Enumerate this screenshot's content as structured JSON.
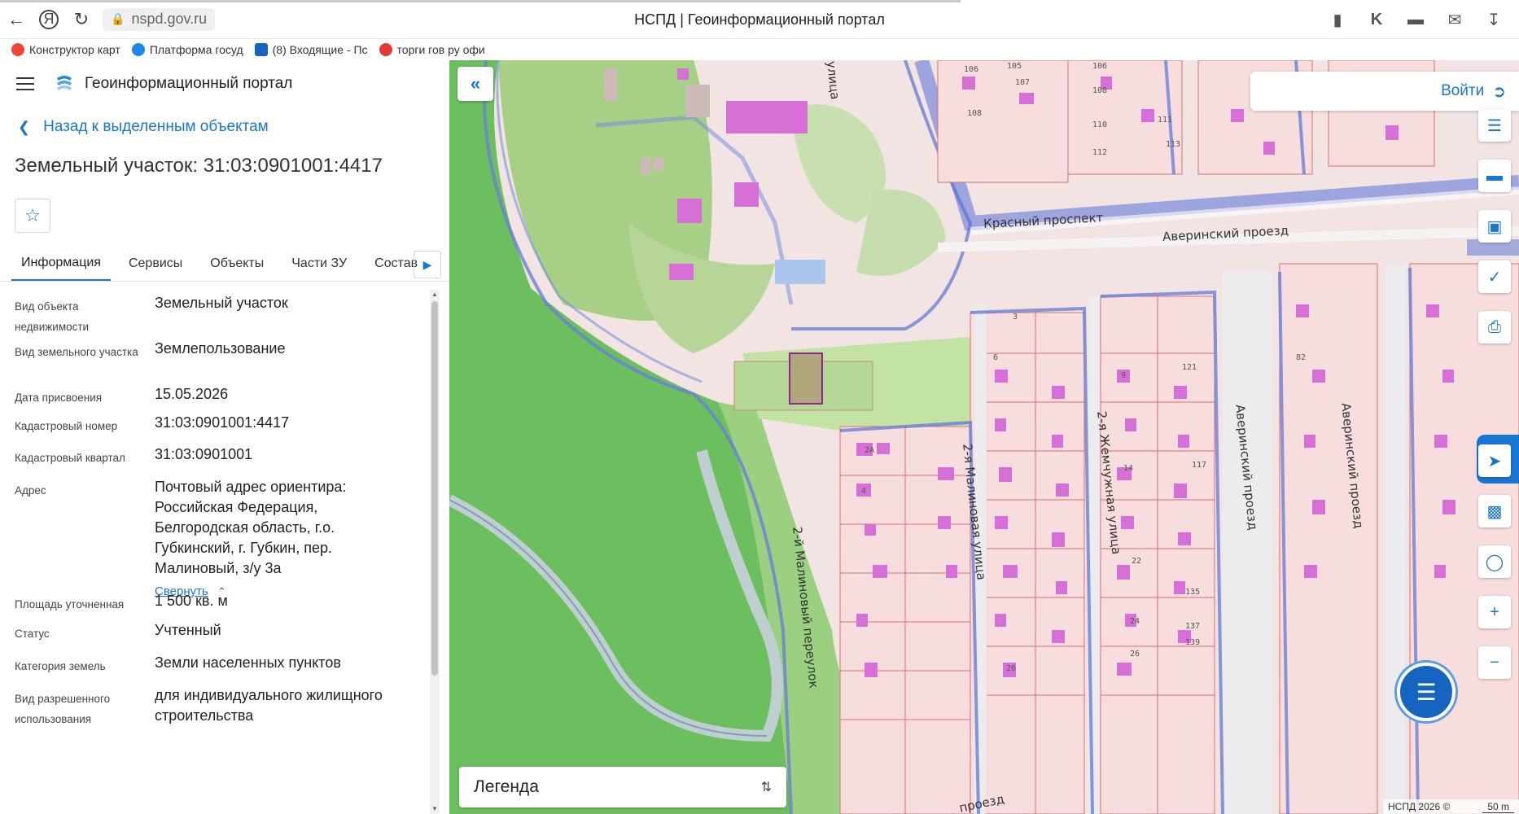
{
  "browser": {
    "url": "nspd.gov.ru",
    "page_title": "НСПД | Геоинформационный портал",
    "bookmarks": [
      {
        "label": "Конструктор карт",
        "color": "#f44336"
      },
      {
        "label": "Платформа госуд",
        "color": "#1e88e5"
      },
      {
        "label": "(8) Входящие - Пс",
        "color": "#1565c0"
      },
      {
        "label": "торги гов ру офи",
        "color": "#e53935"
      }
    ]
  },
  "app": {
    "title": "Геоинформационный портал",
    "back_label": "Назад к выделенным объектам",
    "object_title": "Земельный участок: 31:03:0901001:4417",
    "tabs": [
      {
        "label": "Информация",
        "active": true
      },
      {
        "label": "Сервисы"
      },
      {
        "label": "Объекты"
      },
      {
        "label": "Части ЗУ"
      },
      {
        "label": "Состав"
      }
    ],
    "fields": [
      {
        "label": "Вид объекта недвижимости",
        "value": "Земельный участок"
      },
      {
        "label": "Вид земельного участка",
        "value": "Землепользование"
      },
      {
        "label": "Дата присвоения",
        "value": "15.05.2026"
      },
      {
        "label": "Кадастровый номер",
        "value": "31:03:0901001:4417"
      },
      {
        "label": "Кадастровый квартал",
        "value": "31:03:0901001"
      },
      {
        "label": "Адрес",
        "value": "Почтовый адрес ориентира: Российская Федерация, Белгородская область, г.о. Губкинский, г. Губкин, пер. Малиновый, з/у 3а"
      },
      {
        "label": "Площадь уточненная",
        "value": "1 500 кв. м"
      },
      {
        "label": "Статус",
        "value": "Учтенный"
      },
      {
        "label": "Категория земель",
        "value": "Земли населенных пунктов"
      },
      {
        "label": "Вид разрешенного использования",
        "value": "для индивидуального жилищного строительства"
      }
    ],
    "collapse_label": "Свернуть"
  },
  "map": {
    "login_label": "Войти",
    "legend_label": "Легенда",
    "copyright": "НСПД 2026 ©",
    "scale": "50 m",
    "streets": {
      "krasny": "Красный проспект",
      "averinsky_top": "Аверинский проезд",
      "malinovy_per": "2-й Малиновый переулок",
      "malinovaya": "2-я Малиновая улица",
      "zhemchuzhnaya": "2-я Жемчужная улица",
      "averinsky_1": "Аверинский проезд",
      "averinsky_2": "Аверинский проезд",
      "ulitsa_top": "улица",
      "proezd_bottom": "проезд"
    },
    "house_numbers": [
      "106",
      "105",
      "107",
      "108",
      "106",
      "108",
      "110",
      "111",
      "112",
      "113",
      "3",
      "6",
      "9",
      "121",
      "82",
      "8",
      "10",
      "9",
      "12",
      "11",
      "2А",
      "4",
      "14",
      "117",
      "16",
      "15",
      "20",
      "22",
      "19",
      "20",
      "135",
      "24",
      "137",
      "139",
      "26",
      "26",
      "7",
      "4",
      "3"
    ]
  },
  "colors": {
    "accent": "#1976d2",
    "parcel_fill": "#f7dddd",
    "parcel_line": "#e06b6b",
    "building": "#d66fd6",
    "green_dark": "#6cbf5f",
    "green_light": "#a8d48a",
    "road_blue": "#5a6fd8"
  }
}
